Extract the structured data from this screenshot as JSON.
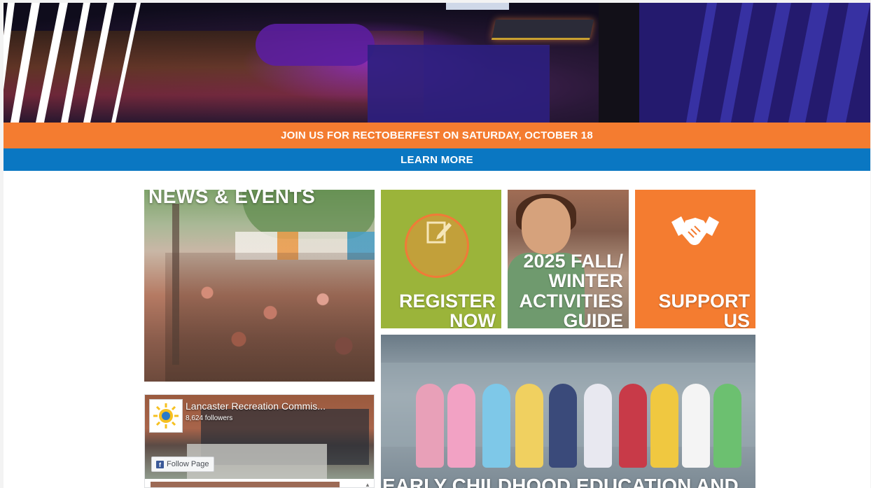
{
  "banner": {
    "event_text": "JOIN US FOR RECTOBERFEST ON SATURDAY, OCTOBER 18",
    "cta_text": "LEARN MORE"
  },
  "tiles": {
    "news_title": "NEWS & EVENTS",
    "register_line1": "REGISTER",
    "register_line2": "NOW",
    "guide_line1": "2025 FALL/",
    "guide_line2": "WINTER",
    "guide_line3": "ACTIVITIES",
    "guide_line4": "GUIDE",
    "support_line1": "SUPPORT",
    "support_line2": "US",
    "ece_title": "EARLY CHILDHOOD EDUCATION AND"
  },
  "facebook": {
    "page_name": "Lancaster Recreation Commis...",
    "followers": "8,624 followers",
    "follow_label": "Follow Page",
    "logo_letter": "f"
  },
  "colors": {
    "orange": "#f47c30",
    "blue": "#0a77c2",
    "green": "#9bb43a"
  }
}
